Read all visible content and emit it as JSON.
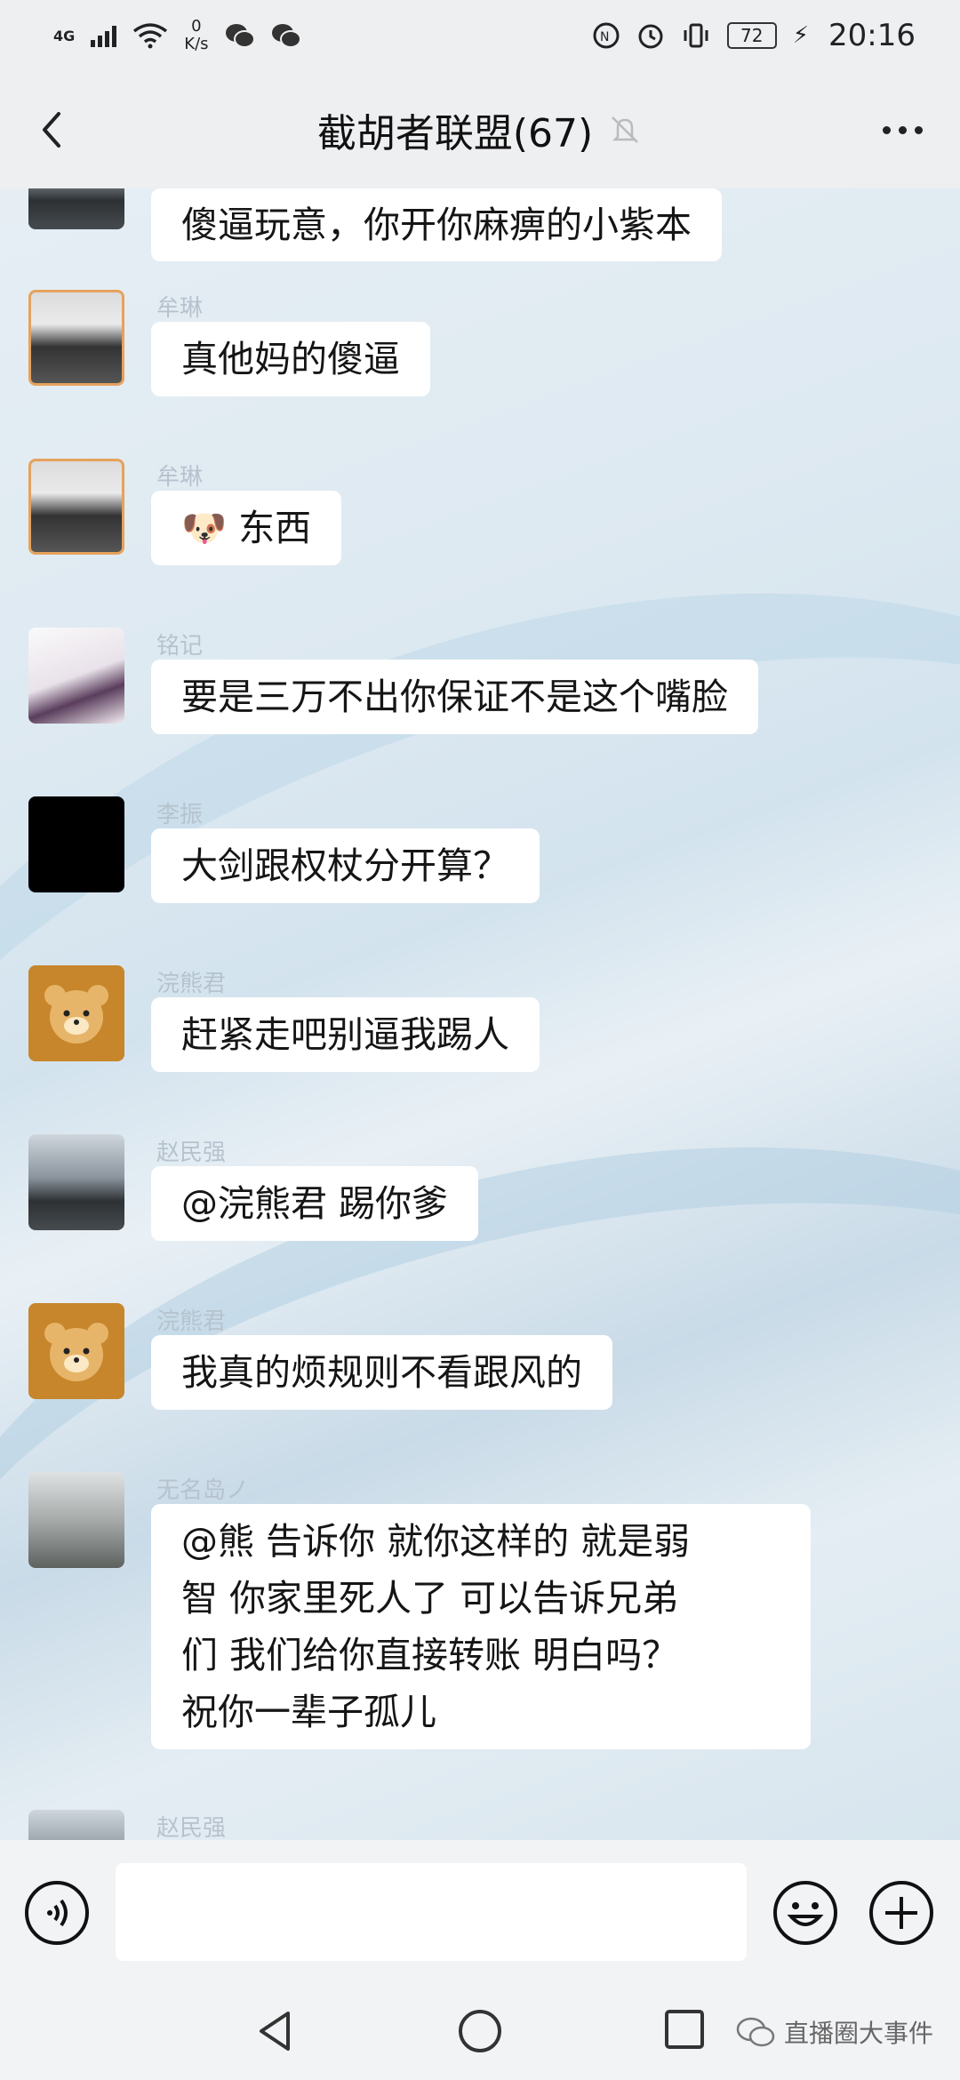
{
  "status_bar": {
    "network": "4G",
    "speed_value": "0",
    "speed_unit": "K/s",
    "battery": "72",
    "time": "20:16"
  },
  "header": {
    "title": "截胡者联盟(67)"
  },
  "messages": [
    {
      "sender": "",
      "text": "傻逼玩意，你开你麻痹的小紫本",
      "avatar": "palm"
    },
    {
      "sender": "牟琳",
      "text": "真他妈的傻逼",
      "avatar": "person"
    },
    {
      "sender": "牟琳",
      "text": "东西",
      "emoji": "🐶",
      "avatar": "person"
    },
    {
      "sender": "铭记",
      "text": "要是三万不出你保证不是这个嘴脸",
      "avatar": "anime"
    },
    {
      "sender": "李振",
      "text": "大剑跟权杖分开算？",
      "avatar": "black"
    },
    {
      "sender": "浣熊君",
      "text": "赶紧走吧别逼我踢人",
      "avatar": "bear"
    },
    {
      "sender": "赵民强",
      "text": "@浣熊君  踢你爹",
      "avatar": "palm"
    },
    {
      "sender": "浣熊君",
      "text": "我真的烦规则不看跟风的",
      "avatar": "bear"
    },
    {
      "sender": "无名岛ノ",
      "text_lines": [
        "@熊  告诉你  就你这样的  就是弱",
        "智  你家里死人了  可以告诉兄弟",
        "们  我们给你直接转账  明白吗？",
        "祝你一辈子孤儿"
      ],
      "avatar": "beach"
    },
    {
      "sender": "赵民强",
      "avatar": "palm"
    }
  ],
  "input": {
    "placeholder": ""
  },
  "watermark": "直播圈大事件",
  "colors": {
    "header_bg": "#eeeff1",
    "bubble_bg": "#ffffff",
    "sender_text": "#b6c3ce",
    "bear_bg": "#c7862b"
  }
}
